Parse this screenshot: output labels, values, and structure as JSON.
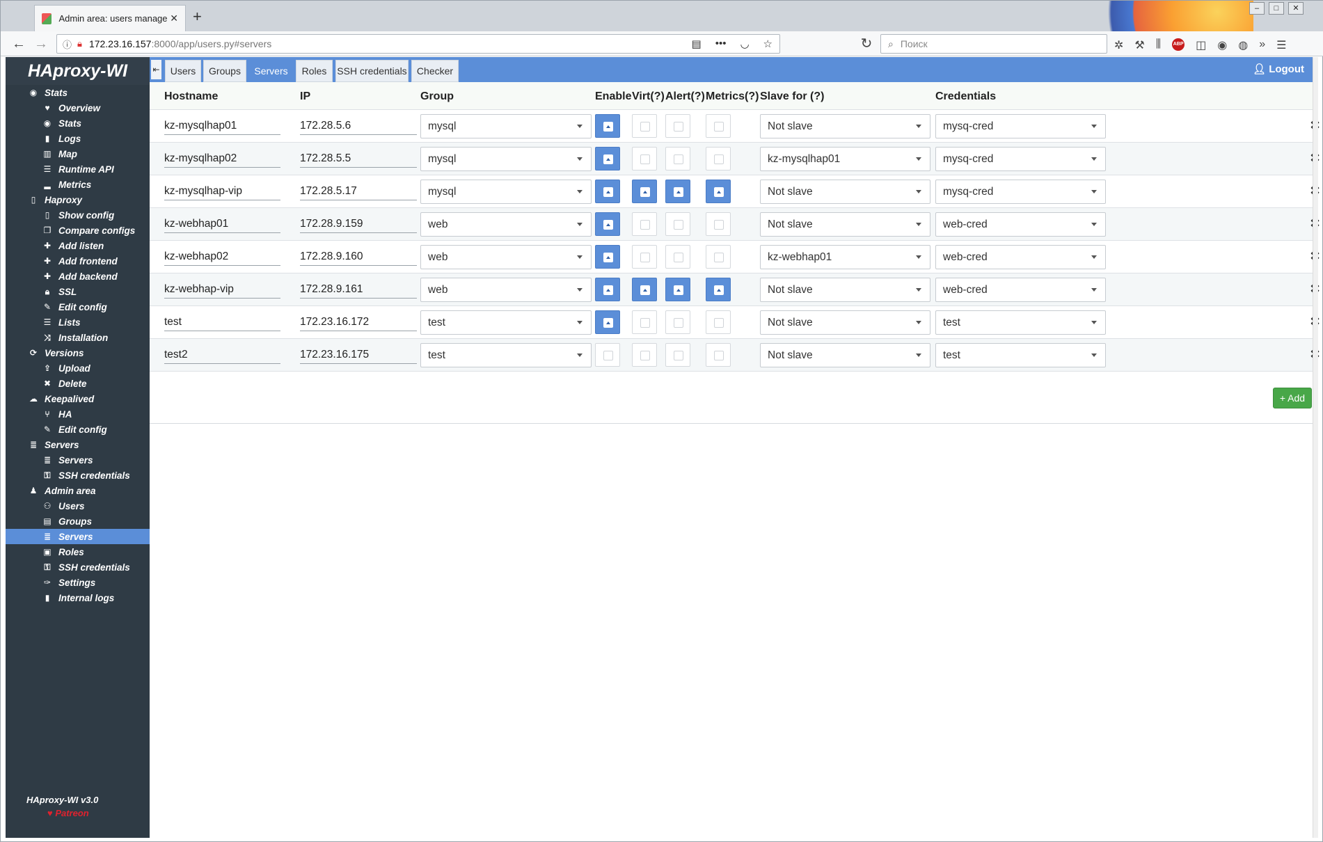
{
  "browser": {
    "tab_title": "Admin area: users manage - H",
    "tab_close": "✕",
    "new_tab": "+",
    "url_host": "172.23.16.157",
    "url_path": ":8000/app/users.py#servers",
    "search_placeholder": "Поиск",
    "window_buttons": [
      "–",
      "□",
      "✕"
    ]
  },
  "app": {
    "logo": "HAproxy-WI",
    "version": "HAproxy-WI v3.0",
    "patreon": "♥ Patreon",
    "logout": "Logout"
  },
  "sidebar": [
    {
      "label": "Stats",
      "level": 1,
      "icon": "eye-icon"
    },
    {
      "label": "Overview",
      "level": 2,
      "icon": "heartbeat-icon"
    },
    {
      "label": "Stats",
      "level": 2,
      "icon": "eye-icon"
    },
    {
      "label": "Logs",
      "level": 2,
      "icon": "book-icon"
    },
    {
      "label": "Map",
      "level": 2,
      "icon": "map-icon"
    },
    {
      "label": "Runtime API",
      "level": 2,
      "icon": "list-icon"
    },
    {
      "label": "Metrics",
      "level": 2,
      "icon": "chart-icon"
    },
    {
      "label": "Haproxy",
      "level": 1,
      "icon": "file-icon"
    },
    {
      "label": "Show config",
      "level": 2,
      "icon": "file-icon"
    },
    {
      "label": "Compare configs",
      "level": 2,
      "icon": "copy-icon"
    },
    {
      "label": "Add listen",
      "level": 2,
      "icon": "plus-icon"
    },
    {
      "label": "Add frontend",
      "level": 2,
      "icon": "plus-icon"
    },
    {
      "label": "Add backend",
      "level": 2,
      "icon": "plus-icon"
    },
    {
      "label": "SSL",
      "level": 2,
      "icon": "lock-icon"
    },
    {
      "label": "Edit config",
      "level": 2,
      "icon": "edit-icon"
    },
    {
      "label": "Lists",
      "level": 2,
      "icon": "list-icon"
    },
    {
      "label": "Installation",
      "level": 2,
      "icon": "shuffle-icon"
    },
    {
      "label": "Versions",
      "level": 1,
      "icon": "sync-icon"
    },
    {
      "label": "Upload",
      "level": 2,
      "icon": "upload-icon"
    },
    {
      "label": "Delete",
      "level": 2,
      "icon": "close-icon"
    },
    {
      "label": "Keepalived",
      "level": 1,
      "icon": "cloud-icon"
    },
    {
      "label": "HA",
      "level": 2,
      "icon": "branch-icon"
    },
    {
      "label": "Edit config",
      "level": 2,
      "icon": "edit-icon"
    },
    {
      "label": "Servers",
      "level": 1,
      "icon": "server-icon"
    },
    {
      "label": "Servers",
      "level": 2,
      "icon": "server-icon"
    },
    {
      "label": "SSH credentials",
      "level": 2,
      "icon": "key-icon"
    },
    {
      "label": "Admin area",
      "level": 1,
      "icon": "user-secret-icon"
    },
    {
      "label": "Users",
      "level": 2,
      "icon": "user-plus-icon"
    },
    {
      "label": "Groups",
      "level": 2,
      "icon": "group-icon"
    },
    {
      "label": "Servers",
      "level": 2,
      "icon": "server-icon",
      "active": true
    },
    {
      "label": "Roles",
      "level": 2,
      "icon": "id-icon"
    },
    {
      "label": "SSH credentials",
      "level": 2,
      "icon": "key-icon"
    },
    {
      "label": "Settings",
      "level": 2,
      "icon": "wrench-icon"
    },
    {
      "label": "Internal logs",
      "level": 2,
      "icon": "book-icon"
    }
  ],
  "tabs": [
    "Users",
    "Groups",
    "Servers",
    "Roles",
    "SSH credentials",
    "Checker"
  ],
  "active_tab": "Servers",
  "table": {
    "headers": [
      "Hostname",
      "IP",
      "Group",
      "Enable",
      "Virt(?)",
      "Alert(?)",
      "Metrics(?)",
      "Slave for (?)",
      "Credentials"
    ],
    "rows": [
      {
        "hostname": "kz-mysqlhap01",
        "ip": "172.28.5.6",
        "group": "mysql",
        "enable": true,
        "virt": false,
        "alert": false,
        "metrics": false,
        "slave": "Not slave",
        "cred": "mysq-cred"
      },
      {
        "hostname": "kz-mysqlhap02",
        "ip": "172.28.5.5",
        "group": "mysql",
        "enable": true,
        "virt": false,
        "alert": false,
        "metrics": false,
        "slave": "kz-mysqlhap01",
        "cred": "mysq-cred"
      },
      {
        "hostname": "kz-mysqlhap-vip",
        "ip": "172.28.5.17",
        "group": "mysql",
        "enable": true,
        "virt": true,
        "alert": true,
        "metrics": true,
        "slave": "Not slave",
        "cred": "mysq-cred"
      },
      {
        "hostname": "kz-webhap01",
        "ip": "172.28.9.159",
        "group": "web",
        "enable": true,
        "virt": false,
        "alert": false,
        "metrics": false,
        "slave": "Not slave",
        "cred": "web-cred"
      },
      {
        "hostname": "kz-webhap02",
        "ip": "172.28.9.160",
        "group": "web",
        "enable": true,
        "virt": false,
        "alert": false,
        "metrics": false,
        "slave": "kz-webhap01",
        "cred": "web-cred"
      },
      {
        "hostname": "kz-webhap-vip",
        "ip": "172.28.9.161",
        "group": "web",
        "enable": true,
        "virt": true,
        "alert": true,
        "metrics": true,
        "slave": "Not slave",
        "cred": "web-cred"
      },
      {
        "hostname": "test",
        "ip": "172.23.16.172",
        "group": "test",
        "enable": true,
        "virt": false,
        "alert": false,
        "metrics": false,
        "slave": "Not slave",
        "cred": "test"
      },
      {
        "hostname": "test2",
        "ip": "172.23.16.175",
        "group": "test",
        "enable": false,
        "virt": false,
        "alert": false,
        "metrics": false,
        "slave": "Not slave",
        "cred": "test"
      }
    ],
    "delete_glyph": "✖"
  },
  "add_button": "+ Add",
  "colors": {
    "accent": "#5b8ed8",
    "sidebar": "#2f3b45",
    "add": "#48a748",
    "patreon": "#e0222e"
  }
}
